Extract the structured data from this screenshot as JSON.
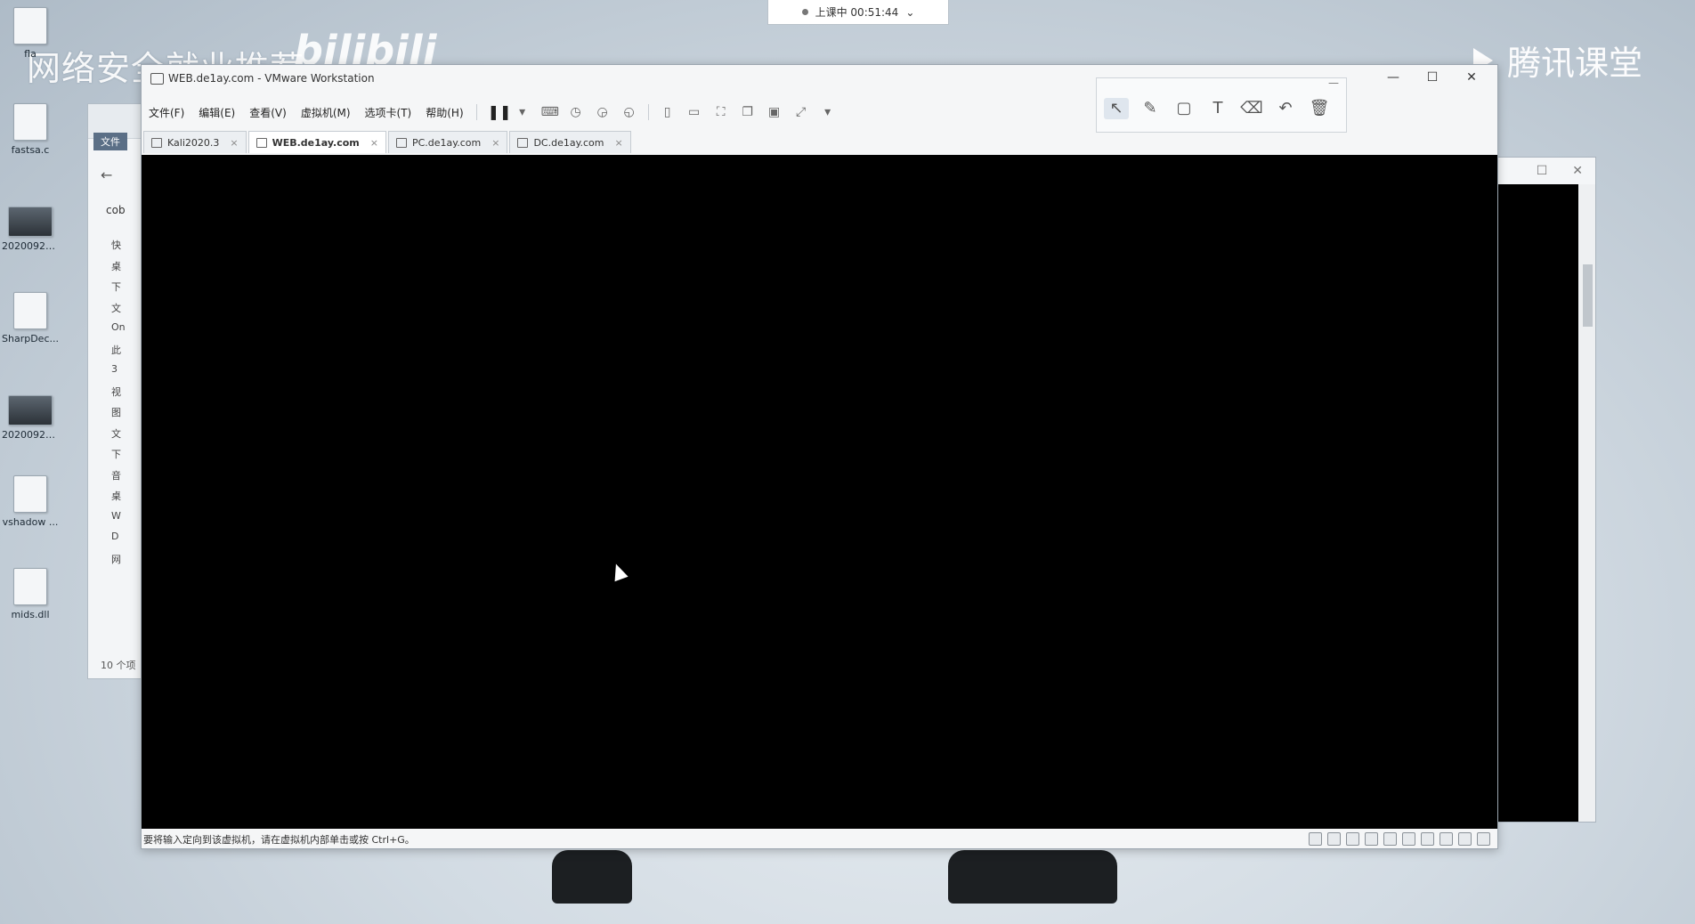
{
  "watermarks": {
    "left_text": "网络安全就业推荐",
    "bilibili": "bilibili",
    "right_text": "腾讯课堂"
  },
  "class_status": {
    "label": "上课中 00:51:44",
    "chevron": "chevron-down-icon"
  },
  "desktop_icons": [
    {
      "label": "fla",
      "icon": "file-icon"
    },
    {
      "label": "fastsa.c",
      "icon": "file-icon"
    },
    {
      "label": "20200927 ...",
      "icon": "video-icon"
    },
    {
      "label": "SharpDec...",
      "icon": "app-icon"
    },
    {
      "label": "20200927 ...",
      "icon": "video-icon"
    },
    {
      "label": "vshadow ...",
      "icon": "file-icon"
    },
    {
      "label": "mids.dll",
      "icon": "file-icon"
    }
  ],
  "explorer": {
    "ribbon_tab": "文件",
    "path_text": "cob",
    "nav_items": [
      "快",
      "桌",
      "下",
      "文",
      "On",
      "此",
      "3",
      "视",
      "图",
      "文",
      "下",
      "音",
      "桌",
      "W",
      "D",
      "网"
    ],
    "item_count": "10 个项"
  },
  "vmware": {
    "title": "WEB.de1ay.com - VMware Workstation",
    "window_controls": {
      "minimize": "—",
      "maximize": "☐",
      "close": "✕"
    },
    "menus": [
      "文件(F)",
      "编辑(E)",
      "查看(V)",
      "虚拟机(M)",
      "选项卡(T)",
      "帮助(H)"
    ],
    "toolbar_icons": [
      "pause-icon",
      "dropdown-icon",
      "send-ctrl-alt-del-icon",
      "snapshot-icon",
      "revert-snapshot-icon",
      "manage-snapshots-icon",
      "library-view-icon",
      "thumbnail-view-icon",
      "fullscreen-icon",
      "unity-icon",
      "console-icon",
      "stretch-icon",
      "dropdown-icon"
    ],
    "tabs": [
      {
        "label": "Kali2020.3",
        "active": false
      },
      {
        "label": "WEB.de1ay.com",
        "active": true
      },
      {
        "label": "PC.de1ay.com",
        "active": false
      },
      {
        "label": "DC.de1ay.com",
        "active": false
      }
    ],
    "status_message": "要将输入定向到该虚拟机，请在虚拟机内部单击或按 Ctrl+G。",
    "status_icons": [
      "hdd-icon",
      "cd-icon",
      "network-icon",
      "network-icon",
      "usb-icon",
      "sound-icon",
      "printer-icon",
      "display-icon",
      "display-icon",
      "message-icon"
    ]
  },
  "annotation_toolbar": {
    "tools": [
      "cursor-arrow-icon",
      "pen-icon",
      "rectangle-icon",
      "text-icon",
      "eraser-icon",
      "undo-icon",
      "trash-icon"
    ],
    "active_tool": "cursor-arrow-icon"
  },
  "right_window": {
    "controls": [
      "☐",
      "✕"
    ]
  }
}
